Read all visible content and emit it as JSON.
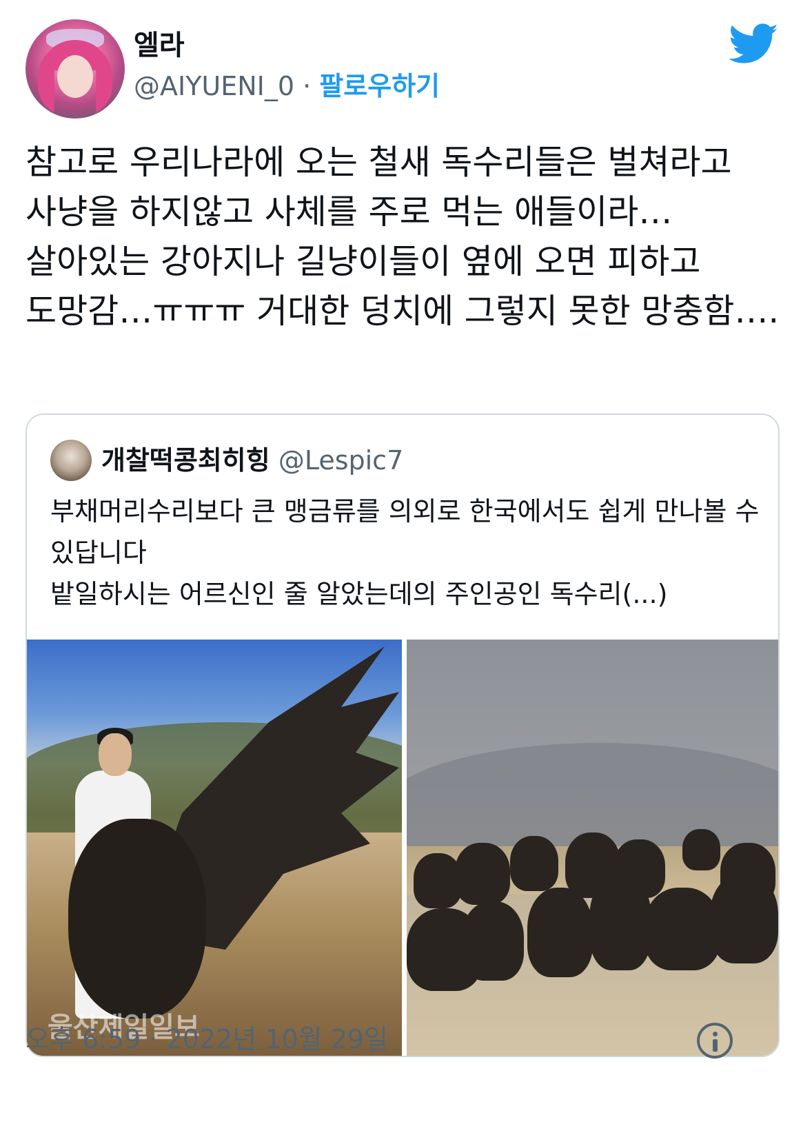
{
  "author": {
    "display_name": "엘라",
    "handle": "@AIYUENI_0",
    "separator": "·",
    "follow_label": "팔로우하기"
  },
  "brand": {
    "icon": "twitter-bird-icon",
    "color": "#1d9bf0"
  },
  "tweet": {
    "text": "참고로 우리나라에 오는 철새 독수리들은 벌쳐라고 사냥을 하지않고 사체를 주로 먹는 애들이라…살아있는 강아지나 길냥이들이 옆에 오면 피하고 도망감…ㅠㅠㅠ 거대한 덩치에 그렇지 못한 망충함…."
  },
  "quote": {
    "display_name": "개찰떡콩최히힝",
    "handle": "@Lespic7",
    "line1": "부채머리수리보다 큰 맹금류를 의외로 한국에서도 쉽게 만나볼 수 있답니다",
    "line2": "밭일하시는 어르신인 줄 알았는데의 주인공인 독수리(...)",
    "media_watermark": "울산제일일보"
  },
  "meta": {
    "timestamp": "오후 6:59 · 2022년 10월 29일",
    "info_icon": "info-icon"
  },
  "colors": {
    "text_primary": "#0f1419",
    "text_secondary": "#536471",
    "border": "#cfd9de",
    "link": "#1d9bf0"
  }
}
